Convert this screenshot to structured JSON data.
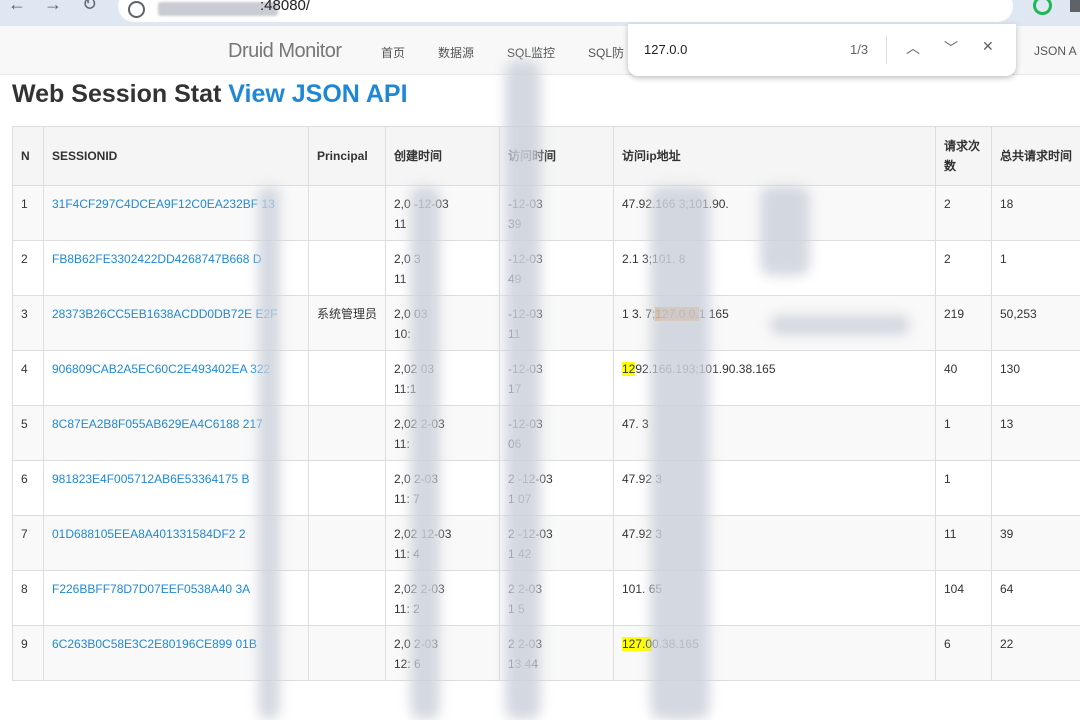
{
  "browser": {
    "url_port": ":48080/"
  },
  "navbar": {
    "brand": "Druid Monitor",
    "links": [
      "首页",
      "数据源",
      "SQL监控",
      "SQL防",
      "JSON A"
    ]
  },
  "findbar": {
    "query": "127.0.0",
    "count": "1/3"
  },
  "page": {
    "title": "Web Session Stat",
    "api_link": "View JSON API"
  },
  "table": {
    "headers": [
      "N",
      "SESSIONID",
      "Principal",
      "创建时间",
      "访问时间",
      "访问ip地址",
      "请求次数",
      "总共请求时间"
    ],
    "rows": [
      {
        "n": "1",
        "sid": "31F4CF297C4DCEA9F12C0EA232BF 13",
        "principal": "",
        "created_1": "2,0 -12-03",
        "created_2": "11",
        "access_1": "-12-03",
        "access_2": "39",
        "ip_pre": "",
        "ip_hl": "",
        "ip_post": "47.92.166 3;101.90.",
        "hl": "",
        "req": "2",
        "total": "18"
      },
      {
        "n": "2",
        "sid": "FB8B62FE3302422DD4268747B668 D",
        "principal": "",
        "created_1": "2,0 3",
        "created_2": "11",
        "access_1": "-12-03",
        "access_2": "49",
        "ip_pre": "",
        "ip_hl": "",
        "ip_post": "2.1 3;101. 8",
        "hl": "",
        "req": "2",
        "total": "1"
      },
      {
        "n": "3",
        "sid": "28373B26CC5EB1638ACDD0DB72E E2F",
        "principal": "系统管理员",
        "created_1": "2,0 03",
        "created_2": "10:",
        "access_1": "-12-03",
        "access_2": "11",
        "ip_pre": "1 3. 7;",
        "ip_hl": "127.0.0.",
        "ip_post": "1 165",
        "hl": "orange",
        "req": "219",
        "total": "50,253"
      },
      {
        "n": "4",
        "sid": "906809CAB2A5EC60C2E493402EA 322",
        "principal": "",
        "created_1": "2,02 03",
        "created_2": "11:1",
        "access_1": "-12-03",
        "access_2": "17",
        "ip_pre": "",
        "ip_hl": "12",
        "ip_post": "92.166.193;101.90.38.165",
        "hl": "yellow",
        "req": "40",
        "total": "130"
      },
      {
        "n": "5",
        "sid": "8C87EA2B8F055AB629EA4C6188 217",
        "principal": "",
        "created_1": "2,02 2-03",
        "created_2": "11:",
        "access_1": "-12-03",
        "access_2": "06",
        "ip_pre": "",
        "ip_hl": "",
        "ip_post": "47. 3",
        "hl": "",
        "req": "1",
        "total": "13"
      },
      {
        "n": "6",
        "sid": "981823E4F005712AB6E53364175 B",
        "principal": "",
        "created_1": "2,0 2-03",
        "created_2": "11: 7",
        "access_1": "2 -12-03",
        "access_2": "1 07",
        "ip_pre": "",
        "ip_hl": "",
        "ip_post": "47.92 3",
        "hl": "",
        "req": "1",
        "total": ""
      },
      {
        "n": "7",
        "sid": "01D688105EEA8A401331584DF2 2",
        "principal": "",
        "created_1": "2,02 12-03",
        "created_2": "11: 4",
        "access_1": "2 -12-03",
        "access_2": "1 42",
        "ip_pre": "",
        "ip_hl": "",
        "ip_post": "47.92 3",
        "hl": "",
        "req": "11",
        "total": "39"
      },
      {
        "n": "8",
        "sid": "F226BBFF78D7D07EEF0538A40 3A",
        "principal": "",
        "created_1": "2,02 2-03",
        "created_2": "11: 2",
        "access_1": "2 2-03",
        "access_2": "1 5",
        "ip_pre": "",
        "ip_hl": "",
        "ip_post": "101. 65",
        "hl": "",
        "req": "104",
        "total": "64"
      },
      {
        "n": "9",
        "sid": "6C263B0C58E3C2E80196CE899 01B",
        "principal": "",
        "created_1": "2,0 2-03",
        "created_2": "12: 6",
        "access_1": "2 2-03",
        "access_2": "13 44",
        "ip_pre": "",
        "ip_hl": "127.0",
        "ip_post": "0.38.165",
        "hl": "yellow",
        "req": "6",
        "total": "22"
      }
    ]
  },
  "colors": {
    "link": "#1e88d6",
    "highlight_current": "#ff9632",
    "highlight_match": "#ffff00"
  }
}
